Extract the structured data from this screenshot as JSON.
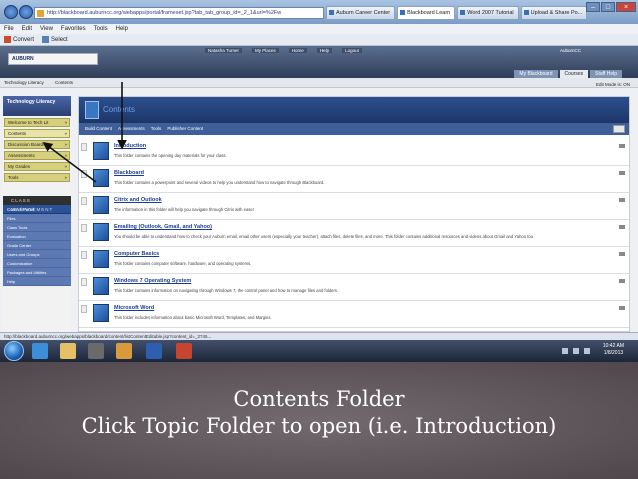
{
  "browser": {
    "url": "http://blackboard.auburncc.org/webapps/portal/frameset.jsp?tab_tab_group_id=_2_1&url=%2Fw",
    "tabs": [
      {
        "label": "Auburn Career Center",
        "active": false
      },
      {
        "label": "Blackboard Learn",
        "active": true
      },
      {
        "label": "Word 2007 Tutorial",
        "active": false
      },
      {
        "label": "Upload & Share Po...",
        "active": false
      }
    ],
    "menu": [
      "File",
      "Edit",
      "View",
      "Favorites",
      "Tools",
      "Help"
    ],
    "toolbar": [
      "Convert",
      "Select"
    ]
  },
  "bb": {
    "logo": "AUBURN",
    "top_links": [
      "Natasha Turner",
      "My Places",
      "Home",
      "Help",
      "Logout"
    ],
    "institution": "AuburnCC",
    "tabs": [
      {
        "label": "My Blackboard",
        "active": false
      },
      {
        "label": "Courses",
        "active": true
      },
      {
        "label": "Staff Help",
        "active": false
      }
    ],
    "breadcrumb": [
      "Technology Literacy",
      "Contents"
    ],
    "edit_mode": "Edit Mode is: ON"
  },
  "leftnav": {
    "course_title": "Technology Literacy",
    "items": [
      "Welcome to Tech Lit",
      "Contents",
      "Discussion Boards",
      "Assessments",
      "My Grades",
      "Tools"
    ],
    "active_index": 1,
    "class_management": "CLASS MANAGEMENT",
    "control_panel": "Control Panel",
    "cp_items": [
      "Files",
      "Class Tools",
      "Evaluation",
      "Grade Center",
      "Users and Groups",
      "Customization",
      "Packages and Utilities",
      "Help"
    ]
  },
  "main": {
    "title": "Contents",
    "actions": [
      "Build Content",
      "Assessments",
      "Tools",
      "Publisher Content"
    ],
    "folders": [
      {
        "title": "Introduction",
        "desc": "This folder contains the opening day materials for your class."
      },
      {
        "title": "Blackboard",
        "desc": "This folder contains a powerpoint and several videos to help you understand how to navigate through Blackboard."
      },
      {
        "title": "Citrix and Outlook",
        "desc": "The information in this folder will help you navigate through Citrix with ease!"
      },
      {
        "title": "Emailing (Outlook, Gmail, and Yahoo)",
        "desc": "You should be able to understand how to check your Auburn email, email other users (especially your teacher), attach files, delete files, and more. This folder contains additional resources and videos about Gmail and Yahoo too."
      },
      {
        "title": "Computer Basics",
        "desc": "This folder contains computer software, hardware, and operating systems."
      },
      {
        "title": "Windows 7 Operating System",
        "desc": "This folder contains information on navigating through Windows 7, the control panel and how to manage files and folders."
      },
      {
        "title": "Microsoft Word",
        "desc": "This folder includes information about basic Microsoft Word, Templates, and Margins."
      }
    ]
  },
  "status_url": "http://blackboard.auburncc.org/webapps/blackboard/content/listContentEditable.jsp?content_id=_2745...",
  "clock": {
    "time": "10:42 AM",
    "date": "1/8/2013"
  },
  "caption": {
    "line1": "Contents Folder",
    "line2": "Click Topic Folder to open (i.e. Introduction)"
  },
  "colors": {
    "bb_nav": "#2c4f8f",
    "nav_item": "#d6d07d",
    "caption_bg": "#5d5358"
  }
}
